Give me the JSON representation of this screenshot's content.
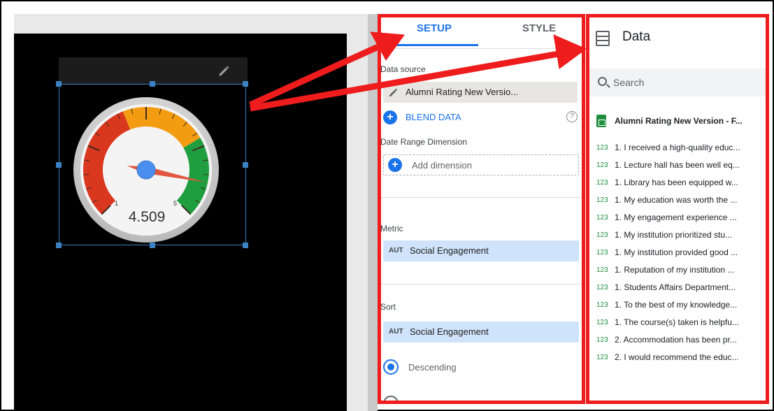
{
  "widget": {
    "gauge_value": "4.509",
    "gauge_min_label": "1",
    "gauge_max_label": "5",
    "needle_fraction": 0.877
  },
  "setup": {
    "tabs": [
      {
        "label": "SETUP",
        "active": true
      },
      {
        "label": "STYLE",
        "active": false
      }
    ],
    "data_source_label": "Data source",
    "data_source_value": "Alumni Rating New Versio...",
    "blend_label": "BLEND DATA",
    "date_range_label": "Date Range Dimension",
    "add_dimension_label": "Add dimension",
    "metric_label": "Metric",
    "metric_type": "AUT",
    "metric_value": "Social Engagement",
    "sort_label": "Sort",
    "sort_type": "AUT",
    "sort_value": "Social Engagement",
    "sort_order": "Descending"
  },
  "data_panel": {
    "title": "Data",
    "search_placeholder": "Search",
    "source_name": "Alumni Rating New Version - F...",
    "fields": [
      {
        "type": "123",
        "name": "1. I received a high-quality educ..."
      },
      {
        "type": "123",
        "name": "1. Lecture hall has been well eq..."
      },
      {
        "type": "123",
        "name": "1. Library has been equipped w..."
      },
      {
        "type": "123",
        "name": "1. My education was worth the ..."
      },
      {
        "type": "123",
        "name": "1. My engagement experience ..."
      },
      {
        "type": "123",
        "name": "1. My institution prioritized stu..."
      },
      {
        "type": "123",
        "name": "1. My institution provided good ..."
      },
      {
        "type": "123",
        "name": "1. Reputation of my institution ..."
      },
      {
        "type": "123",
        "name": "1. Students Affairs Department..."
      },
      {
        "type": "123",
        "name": "1. To the best of my knowledge..."
      },
      {
        "type": "123",
        "name": "1. The course(s) taken is helpfu..."
      },
      {
        "type": "123",
        "name": "2. Accommodation has been pr..."
      },
      {
        "type": "123",
        "name": "2. I would recommend the educ..."
      }
    ]
  },
  "colors": {
    "accent": "#1a73e8",
    "highlight_frame": "#ee1c1c",
    "gauge_red": "#d9381e",
    "gauge_orange": "#f39c12",
    "gauge_green": "#1e9e3e"
  }
}
